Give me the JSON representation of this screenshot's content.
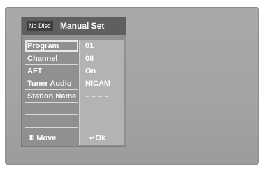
{
  "badge": "No Disc",
  "title": "Manual Set",
  "rows": [
    {
      "label": "Program",
      "value": "01",
      "selected": true
    },
    {
      "label": "Channel",
      "value": "08",
      "selected": false
    },
    {
      "label": "AFT",
      "value": "On",
      "selected": false
    },
    {
      "label": "Tuner Audio",
      "value": "NICAM",
      "selected": false
    },
    {
      "label": "Station Name",
      "value": "– – – –",
      "selected": false
    },
    {
      "label": "",
      "value": "",
      "selected": false
    },
    {
      "label": "",
      "value": "",
      "selected": false
    }
  ],
  "footer": {
    "move_icon": "⬍",
    "move_label": "Move",
    "ok_icon": "↵",
    "ok_label": "Ok"
  }
}
